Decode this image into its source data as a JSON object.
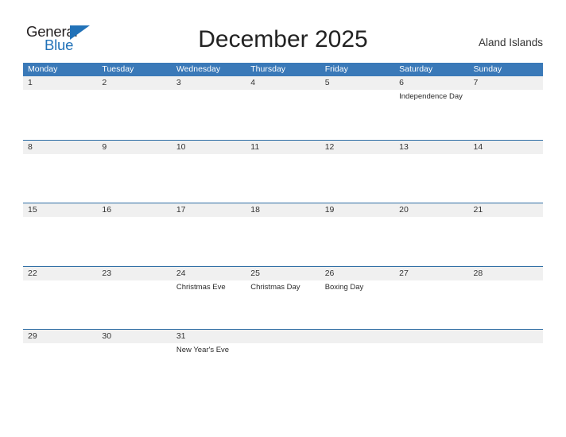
{
  "brand": {
    "name_part1": "General",
    "name_part2": "Blue",
    "triangle_color": "#2272b8",
    "text_color": "#231f20"
  },
  "header": {
    "title": "December 2025",
    "locale": "Aland Islands"
  },
  "colors": {
    "weekday_header_bg": "#3a79b8",
    "weekday_header_text": "#ffffff",
    "daynum_band_bg": "#f0f0f0",
    "week_separator": "#2e6da4",
    "page_bg": "#ffffff",
    "event_text": "#2b2b2b"
  },
  "calendar": {
    "month": "December",
    "year": "2025",
    "weekday_headers": [
      "Monday",
      "Tuesday",
      "Wednesday",
      "Thursday",
      "Friday",
      "Saturday",
      "Sunday"
    ],
    "weeks": [
      {
        "days": [
          {
            "num": "1",
            "events": []
          },
          {
            "num": "2",
            "events": []
          },
          {
            "num": "3",
            "events": []
          },
          {
            "num": "4",
            "events": []
          },
          {
            "num": "5",
            "events": []
          },
          {
            "num": "6",
            "events": [
              "Independence Day"
            ]
          },
          {
            "num": "7",
            "events": []
          }
        ]
      },
      {
        "days": [
          {
            "num": "8",
            "events": []
          },
          {
            "num": "9",
            "events": []
          },
          {
            "num": "10",
            "events": []
          },
          {
            "num": "11",
            "events": []
          },
          {
            "num": "12",
            "events": []
          },
          {
            "num": "13",
            "events": []
          },
          {
            "num": "14",
            "events": []
          }
        ]
      },
      {
        "days": [
          {
            "num": "15",
            "events": []
          },
          {
            "num": "16",
            "events": []
          },
          {
            "num": "17",
            "events": []
          },
          {
            "num": "18",
            "events": []
          },
          {
            "num": "19",
            "events": []
          },
          {
            "num": "20",
            "events": []
          },
          {
            "num": "21",
            "events": []
          }
        ]
      },
      {
        "days": [
          {
            "num": "22",
            "events": []
          },
          {
            "num": "23",
            "events": []
          },
          {
            "num": "24",
            "events": [
              "Christmas Eve"
            ]
          },
          {
            "num": "25",
            "events": [
              "Christmas Day"
            ]
          },
          {
            "num": "26",
            "events": [
              "Boxing Day"
            ]
          },
          {
            "num": "27",
            "events": []
          },
          {
            "num": "28",
            "events": []
          }
        ]
      },
      {
        "days": [
          {
            "num": "29",
            "events": []
          },
          {
            "num": "30",
            "events": []
          },
          {
            "num": "31",
            "events": [
              "New Year's Eve"
            ]
          },
          {
            "num": "",
            "events": []
          },
          {
            "num": "",
            "events": []
          },
          {
            "num": "",
            "events": []
          },
          {
            "num": "",
            "events": []
          }
        ]
      }
    ]
  }
}
